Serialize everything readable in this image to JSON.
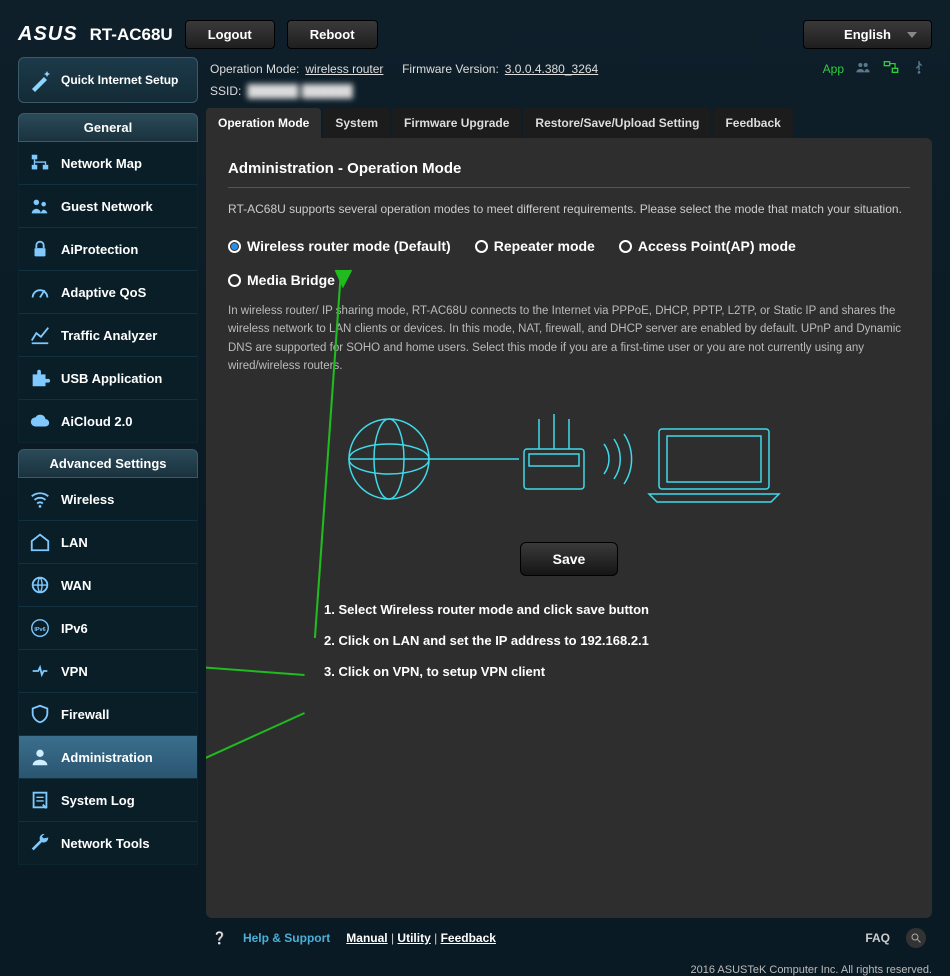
{
  "brand": "ASUS",
  "model": "RT-AC68U",
  "topbar": {
    "logout": "Logout",
    "reboot": "Reboot",
    "language": "English"
  },
  "meta": {
    "op_mode_label": "Operation Mode:",
    "op_mode_value": "wireless router",
    "fw_label": "Firmware Version:",
    "fw_value": "3.0.0.4.380_3264",
    "ssid_label": "SSID:",
    "ssid_value": "██████  ██████",
    "app": "App"
  },
  "qis": "Quick Internet Setup",
  "sections": {
    "general": "General",
    "advanced": "Advanced Settings"
  },
  "general": [
    {
      "key": "network-map",
      "label": "Network Map"
    },
    {
      "key": "guest-network",
      "label": "Guest Network"
    },
    {
      "key": "aiprotection",
      "label": "AiProtection"
    },
    {
      "key": "adaptive-qos",
      "label": "Adaptive QoS"
    },
    {
      "key": "traffic-analyzer",
      "label": "Traffic Analyzer"
    },
    {
      "key": "usb-application",
      "label": "USB Application"
    },
    {
      "key": "aicloud",
      "label": "AiCloud 2.0"
    }
  ],
  "advanced": [
    {
      "key": "wireless",
      "label": "Wireless"
    },
    {
      "key": "lan",
      "label": "LAN"
    },
    {
      "key": "wan",
      "label": "WAN"
    },
    {
      "key": "ipv6",
      "label": "IPv6"
    },
    {
      "key": "vpn",
      "label": "VPN"
    },
    {
      "key": "firewall",
      "label": "Firewall"
    },
    {
      "key": "administration",
      "label": "Administration"
    },
    {
      "key": "system-log",
      "label": "System Log"
    },
    {
      "key": "network-tools",
      "label": "Network Tools"
    }
  ],
  "tabs": [
    "Operation Mode",
    "System",
    "Firmware Upgrade",
    "Restore/Save/Upload Setting",
    "Feedback"
  ],
  "page": {
    "title": "Administration - Operation Mode",
    "desc": "RT-AC68U supports several operation modes to meet different requirements. Please select the mode that match your situation.",
    "modes": [
      "Wireless router mode (Default)",
      "Repeater mode",
      "Access Point(AP) mode",
      "Media Bridge"
    ],
    "mode_desc": "In wireless router/ IP sharing mode, RT-AC68U connects to the Internet via PPPoE, DHCP, PPTP, L2TP, or Static IP and shares the wireless network to LAN clients or devices. In this mode, NAT, firewall, and DHCP server are enabled by default. UPnP and Dynamic DNS are supported for SOHO and home users. Select this mode if you are a first-time user or you are not currently using any wired/wireless routers.",
    "save": "Save"
  },
  "annotations": [
    "1. Select Wireless router mode and click save button",
    "2. Click on LAN and set the IP address to 192.168.2.1",
    "3. Click on VPN, to setup VPN client"
  ],
  "footer": {
    "help": "Help & Support",
    "manual": "Manual",
    "utility": "Utility",
    "feedback": "Feedback",
    "faq": "FAQ"
  },
  "copyright": "2016 ASUSTeK Computer Inc. All rights reserved."
}
